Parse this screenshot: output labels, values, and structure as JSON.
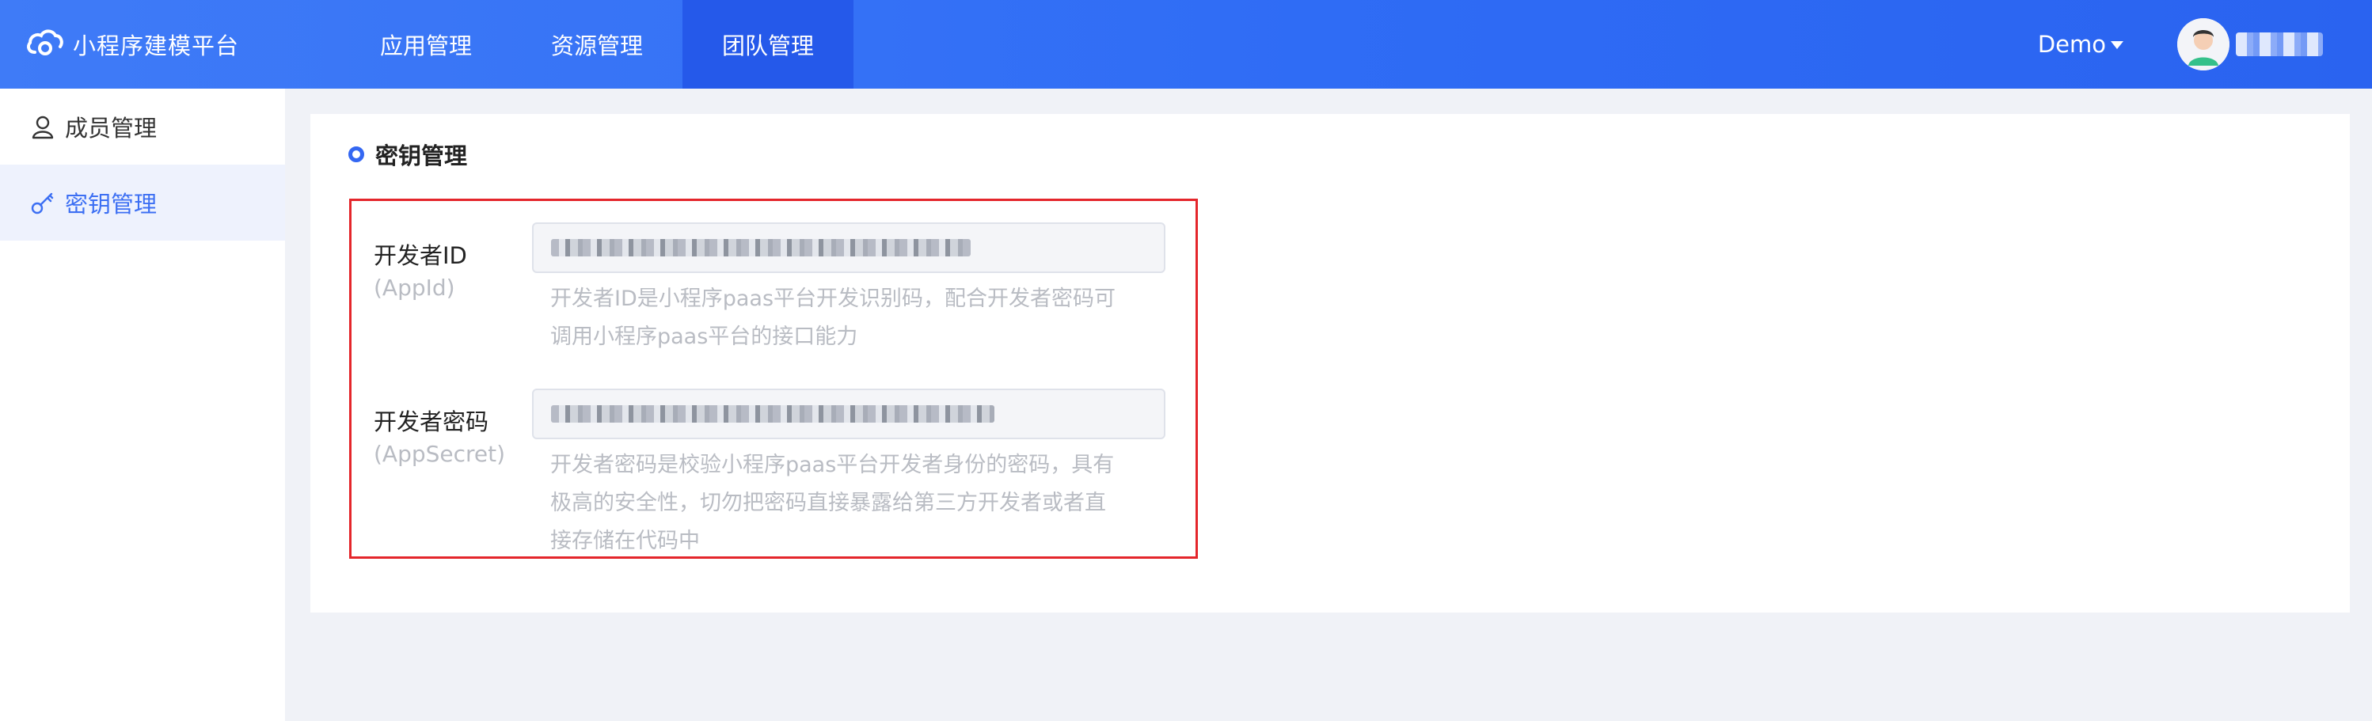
{
  "brand": {
    "name": "小程序建模平台",
    "icon": "cloud-logo-icon"
  },
  "nav": {
    "items": [
      {
        "label": "应用管理",
        "active": false
      },
      {
        "label": "资源管理",
        "active": false
      },
      {
        "label": "团队管理",
        "active": true
      }
    ]
  },
  "header": {
    "env_label": "Demo",
    "user_avatar": "avatar-icon"
  },
  "sidebar": {
    "items": [
      {
        "label": "成员管理",
        "icon": "user-icon",
        "active": false
      },
      {
        "label": "密钥管理",
        "icon": "key-icon",
        "active": true
      }
    ]
  },
  "main": {
    "section_title": "密钥管理",
    "fields": [
      {
        "label": "开发者ID",
        "sublabel": "(AppId)",
        "value": "",
        "help_lines": [
          "开发者ID是小程序paas平台开发识别码，配合开发者密码可",
          "调用小程序paas平台的接口能力"
        ]
      },
      {
        "label": "开发者密码",
        "sublabel": "(AppSecret)",
        "value": "",
        "help_lines": [
          "开发者密码是校验小程序paas平台开发者身份的密码，具有",
          "极高的安全性，切勿把密码直接暴露给第三方开发者或者直",
          "接存储在代码中"
        ]
      }
    ]
  },
  "colors": {
    "primary": "#3c6ff3",
    "topbar": "#2f6cf5",
    "highlight_border": "#e4262b"
  }
}
